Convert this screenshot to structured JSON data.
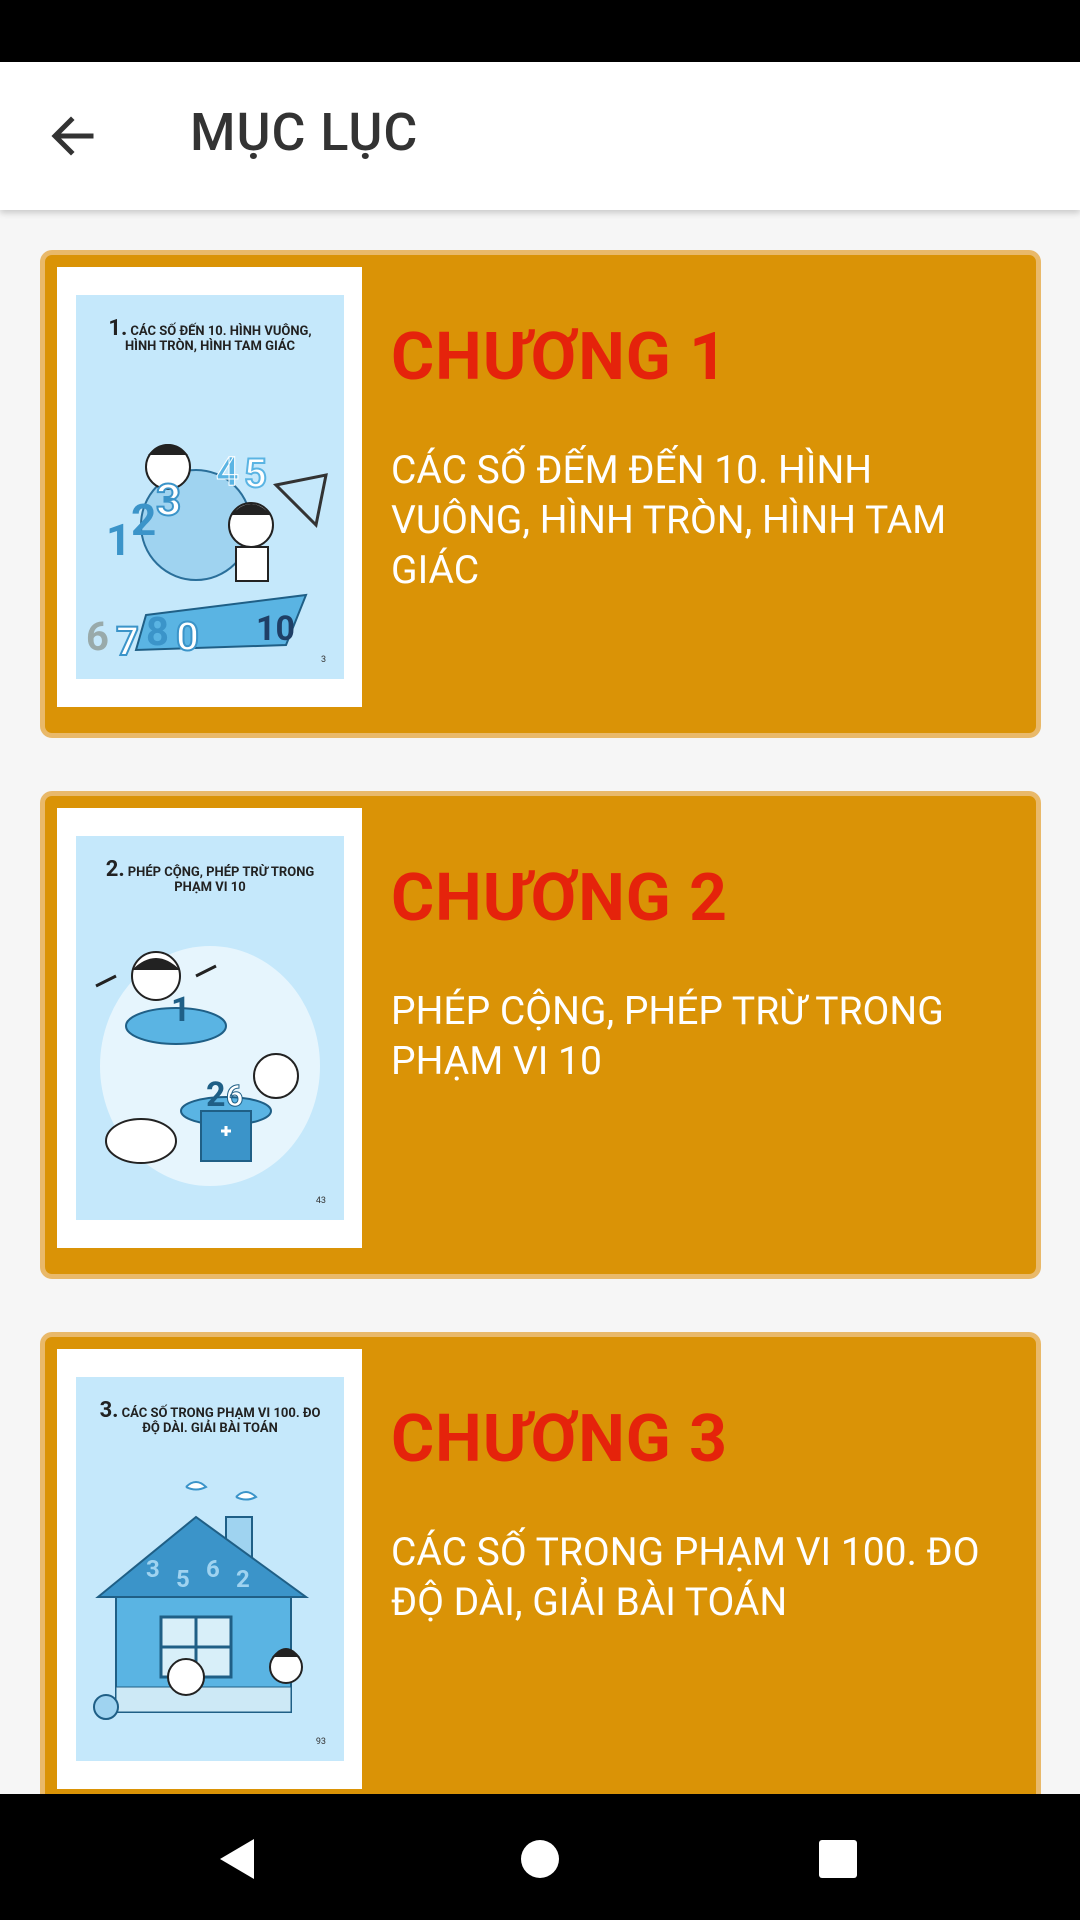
{
  "app_bar": {
    "back_icon": "arrow-left-icon",
    "title": "MỤC LỤC"
  },
  "chapters": [
    {
      "heading": "CHƯƠNG 1",
      "description": "CÁC SỐ ĐẾM ĐẾN 10. HÌNH VUÔNG, HÌNH TRÒN, HÌNH TAM GIÁC",
      "cover": {
        "number": "1.",
        "title": "CÁC SỐ ĐẾN 10. HÌNH VUÔNG, HÌNH TRÒN, HÌNH TAM GIÁC",
        "page": "3",
        "art_digits": [
          "1",
          "2",
          "3",
          "4",
          "5",
          "6",
          "7",
          "8",
          "0",
          "10"
        ]
      }
    },
    {
      "heading": "CHƯƠNG 2",
      "description": "PHÉP CỘNG, PHÉP TRỪ TRONG PHẠM VI 10",
      "cover": {
        "number": "2.",
        "title": "PHÉP CỘNG, PHÉP TRỪ TRONG PHẠM VI 10",
        "page": "43",
        "art_digits": [
          "1",
          "2",
          "6"
        ]
      }
    },
    {
      "heading": "CHƯƠNG 3",
      "description": "CÁC SỐ TRONG PHẠM VI 100. ĐO ĐỘ DÀI, GIẢI BÀI TOÁN",
      "cover": {
        "number": "3.",
        "title": "CÁC SỐ TRONG PHẠM VI 100. ĐO ĐỘ DÀI. GIẢI BÀI TOÁN",
        "page": "93",
        "art_digits": [
          "3",
          "5",
          "6",
          "2"
        ]
      }
    }
  ],
  "nav_bar": {
    "back_icon": "triangle-back-icon",
    "home_icon": "circle-home-icon",
    "recents_icon": "square-recents-icon"
  },
  "colors": {
    "card_bg": "#da9306",
    "card_border": "#e9b96a",
    "heading": "#e5230b",
    "description": "#ffffff",
    "cover_bg": "#c5e8fb"
  }
}
